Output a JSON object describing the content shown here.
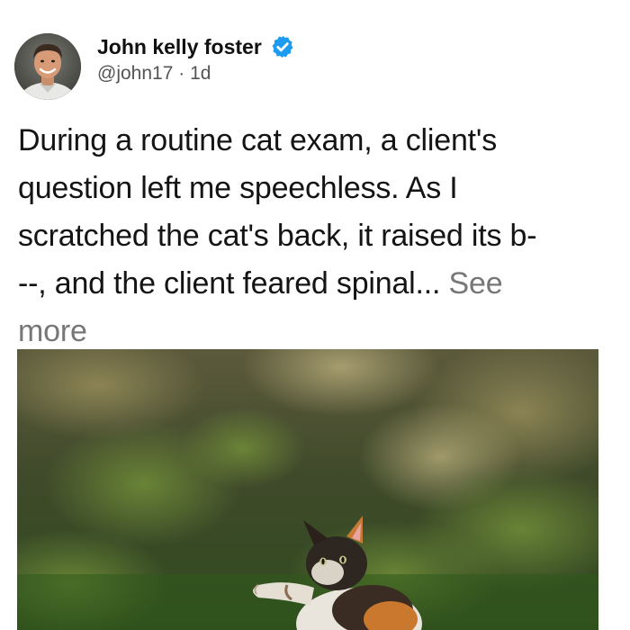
{
  "author": {
    "name": "John kelly foster",
    "handle": "@john17",
    "separator": "·",
    "age": "1d",
    "verified_icon": "verified-check-icon",
    "verified_color": "#1d9bf0"
  },
  "post": {
    "lines": [
      "During a routine cat exam, a client's",
      "question left me speechless. As I",
      "scratched the cat's back, it raised its b-",
      "--, and the client feared spinal... "
    ],
    "see_more_a": "See",
    "see_more_b": "more"
  },
  "media": {
    "icon": "photo-icon",
    "subject": "cat"
  },
  "colors": {
    "text": "#141414",
    "muted": "#555555",
    "link_muted": "#777777",
    "background": "#ffffff"
  }
}
